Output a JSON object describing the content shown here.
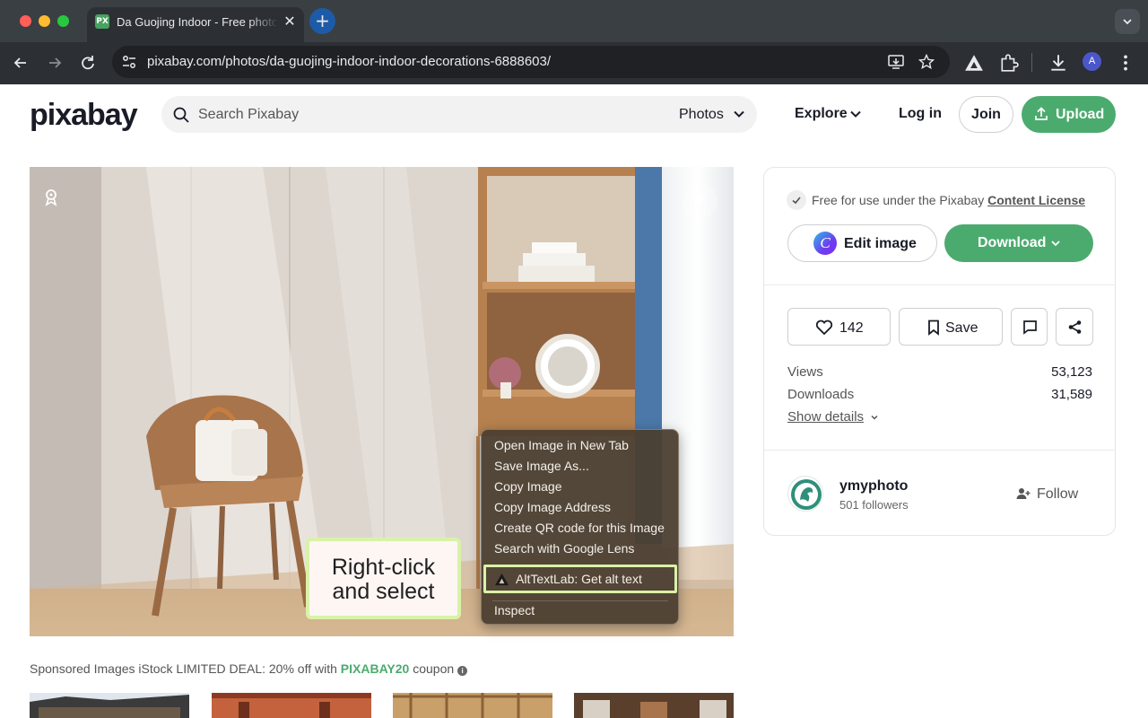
{
  "browser": {
    "tab_title": "Da Guojing Indoor - Free photo",
    "tab_favicon": "PX",
    "url": "pixabay.com/photos/da-guojing-indoor-indoor-decorations-6888603/",
    "profile_initial": "A"
  },
  "header": {
    "logo": "pixabay",
    "search_placeholder": "Search Pixabay",
    "search_type": "Photos",
    "explore": "Explore",
    "login": "Log in",
    "join": "Join",
    "upload": "Upload"
  },
  "callout": {
    "line1": "Right-click",
    "line2": "and select"
  },
  "context_menu": {
    "items": [
      "Open Image in New Tab",
      "Save Image As...",
      "Copy Image",
      "Copy Image Address",
      "Create QR code for this Image",
      "Search with Google Lens"
    ],
    "highlighted": "AltTextLab: Get alt text",
    "inspect": "Inspect"
  },
  "sponsored": {
    "prefix": "Sponsored Images iStock LIMITED DEAL: 20% off with ",
    "code": "PIXABAY20",
    "suffix": " coupon"
  },
  "sidebar": {
    "license_prefix": "Free for use under the Pixabay ",
    "license_link": "Content License",
    "edit_image": "Edit image",
    "download": "Download",
    "likes": "142",
    "save": "Save",
    "stats": [
      {
        "label": "Views",
        "value": "53,123"
      },
      {
        "label": "Downloads",
        "value": "31,589"
      }
    ],
    "show_details": "Show details",
    "user": {
      "name": "ymyphoto",
      "followers": "501 followers",
      "follow": "Follow"
    }
  },
  "colors": {
    "accent": "#4bab6e",
    "callout_border": "#d9f2a8",
    "chrome_dark": "#2c2f33"
  }
}
